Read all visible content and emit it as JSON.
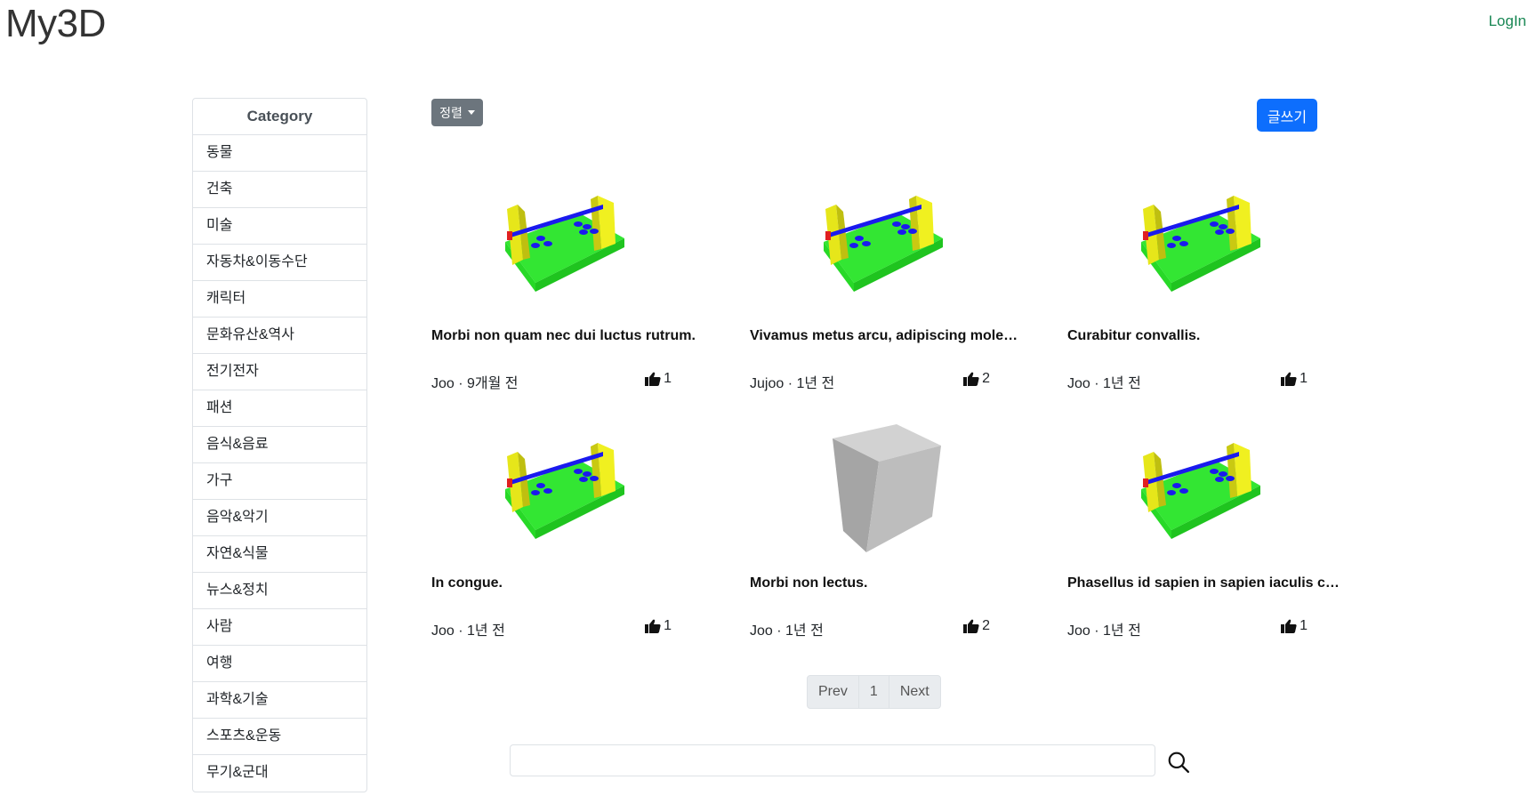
{
  "header": {
    "brand": "My3D",
    "login": "LogIn"
  },
  "sidebar": {
    "title": "Category",
    "items": [
      {
        "label": "동물"
      },
      {
        "label": "건축"
      },
      {
        "label": "미술"
      },
      {
        "label": "자동차&이동수단"
      },
      {
        "label": "캐릭터"
      },
      {
        "label": "문화유산&역사"
      },
      {
        "label": "전기전자"
      },
      {
        "label": "패션"
      },
      {
        "label": "음식&음료"
      },
      {
        "label": "가구"
      },
      {
        "label": "음악&악기"
      },
      {
        "label": "자연&식물"
      },
      {
        "label": "뉴스&정치"
      },
      {
        "label": "사람"
      },
      {
        "label": "여행"
      },
      {
        "label": "과학&기술"
      },
      {
        "label": "스포츠&운동"
      },
      {
        "label": "무기&군대"
      }
    ]
  },
  "toolbar": {
    "sort_label": "정렬",
    "write_label": "글쓰기"
  },
  "posts": [
    {
      "title": "Morbi non quam nec dui luctus rutrum.",
      "meta": "Joo · 9개월 전",
      "likes": "1",
      "thumb": "assembly-model"
    },
    {
      "title": "Vivamus metus arcu, adipiscing molestie, hendrerit at, vulputate vitae, nisl.",
      "meta": "Jujoo · 1년 전",
      "likes": "2",
      "thumb": "assembly-model"
    },
    {
      "title": "Curabitur convallis.",
      "meta": "Joo · 1년 전",
      "likes": "1",
      "thumb": "assembly-model"
    },
    {
      "title": "In congue.",
      "meta": "Joo · 1년 전",
      "likes": "1",
      "thumb": "assembly-model"
    },
    {
      "title": "Morbi non lectus.",
      "meta": "Joo · 1년 전",
      "likes": "2",
      "thumb": "gray-cube"
    },
    {
      "title": "Phasellus id sapien in sapien iaculis congue.",
      "meta": "Joo · 1년 전",
      "likes": "1",
      "thumb": "assembly-model"
    }
  ],
  "pagination": {
    "prev": "Prev",
    "current": "1",
    "next": "Next"
  },
  "search": {
    "placeholder": ""
  },
  "icons": {
    "like": "thumbs-up-icon",
    "search": "search-icon"
  }
}
